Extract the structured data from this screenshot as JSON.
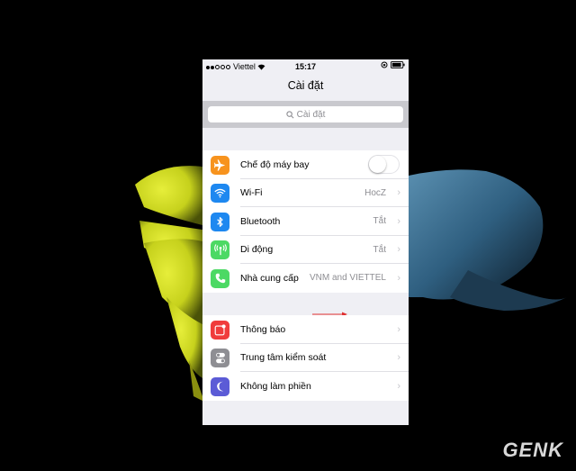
{
  "status_bar": {
    "carrier": "Viettel",
    "time": "15:17"
  },
  "nav": {
    "title": "Cài đặt"
  },
  "search": {
    "placeholder": "Cài đặt"
  },
  "group1": [
    {
      "label": "Chế độ máy bay",
      "icon": "airplane-icon",
      "color": "#f7931e",
      "type": "toggle",
      "toggle_on": false
    },
    {
      "label": "Wi-Fi",
      "icon": "wifi-icon",
      "color": "#1e88f0",
      "value": "HocZ"
    },
    {
      "label": "Bluetooth",
      "icon": "bluetooth-icon",
      "color": "#1e88f0",
      "value": "Tắt"
    },
    {
      "label": "Di động",
      "icon": "cellular-icon",
      "color": "#4cd964",
      "value": "Tắt"
    },
    {
      "label": "Nhà cung cấp",
      "icon": "phone-icon",
      "color": "#4cd964",
      "value": "VNM and VIETTEL"
    }
  ],
  "group2": [
    {
      "label": "Thông báo",
      "icon": "notifications-icon",
      "color": "#f03c3c"
    },
    {
      "label": "Trung tâm kiểm soát",
      "icon": "control-center-icon",
      "color": "#8e8e93"
    },
    {
      "label": "Không làm phiền",
      "icon": "moon-icon",
      "color": "#5b5bd6"
    }
  ],
  "watermark": "GENK",
  "colors": {
    "accent": "#1e88f0",
    "arrow": "#e03030"
  }
}
